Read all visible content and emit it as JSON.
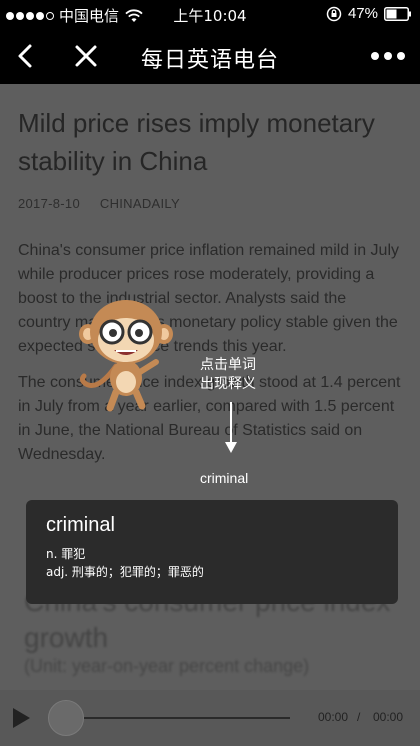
{
  "status_bar": {
    "carrier": "中国电信",
    "time": "上午10:04",
    "battery": "47%"
  },
  "nav": {
    "title": "每日英语电台"
  },
  "article": {
    "headline": "Mild price rises imply monetary stability in China",
    "date": "2017-8-10",
    "source": "CHINADAILY",
    "paragraph1": "China's consumer price inflation remained mild in July while producer prices rose moderately, providing a boost to the industrial sector. Analysts said the country may keep its monetary policy stable given the expected stable price trends this year.",
    "paragraph2": "The consumer price index growth stood at 1.4 percent in July from a year earlier, compared with 1.5 percent in June, the National Bureau of Statistics said on Wednesday.",
    "chart_title": "China's consumer price index growth",
    "chart_subtitle": "(Unit: year-on-year percent change)"
  },
  "popup": {
    "word": "criminal",
    "definition_noun": "n. 罪犯",
    "definition_adj": "adj. 刑事的；犯罪的；罪恶的"
  },
  "hint": {
    "line1": "点击单词",
    "line2": "出现释义",
    "example_word": "criminal"
  },
  "player": {
    "current_time": "00:00",
    "separator": "/",
    "total_time": "00:00"
  }
}
